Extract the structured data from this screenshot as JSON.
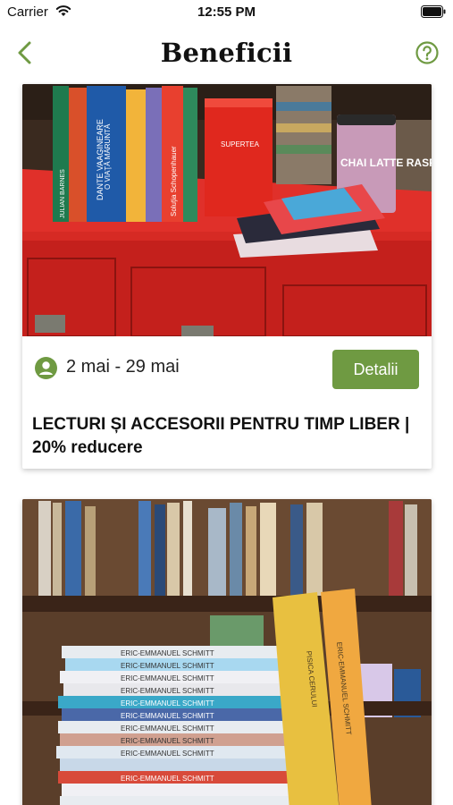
{
  "status_bar": {
    "carrier": "Carrier",
    "time": "12:55 PM"
  },
  "nav": {
    "title": "Beneficii",
    "back_icon": "chevron-left-icon",
    "help_icon": "question-circle-icon"
  },
  "colors": {
    "accent_green": "#6f9a42",
    "title_text": "#111111",
    "background": "#ffffff"
  },
  "cards": [
    {
      "image": "photo-books-and-tea-on-red-cabinet",
      "date_range": "2 mai - 29 mai",
      "button_label": "Detalii",
      "title": "LECTURI ȘI ACCESORII PENTRU TIMP LIBER | 20% reducere",
      "book_texts": [
        "JULIAN BARNES",
        "DANTE VAAGINEARE",
        "O VIAŢĂ MĂRUNTĂ",
        "Soluţia Schopenhauer",
        "SUPERTEA",
        "CHAI LATTE RASPBERRY"
      ]
    },
    {
      "image": "photo-stack-of-books-in-library",
      "book_texts": [
        "ERIC-EMMANUEL SCHMITT",
        "ERIC-EMMANUEL SCHMITT",
        "ERIC-EMMANUEL SCHMITT",
        "ERIC-EMMANUEL SCHMITT",
        "ERIC-EMMANUEL SCHMITT",
        "ERIC-EMMANUEL SCHMITT",
        "ERIC-EMMANUEL SCHMITT",
        "ERIC-EMMANUEL SCHMITT",
        "ERIC-EMMANUEL SCHMITT",
        "ERIC-EMMANUEL SCHMITT",
        "PISICA CERULUI",
        "ERIC-EMMANUEL SCHMITT"
      ]
    }
  ]
}
